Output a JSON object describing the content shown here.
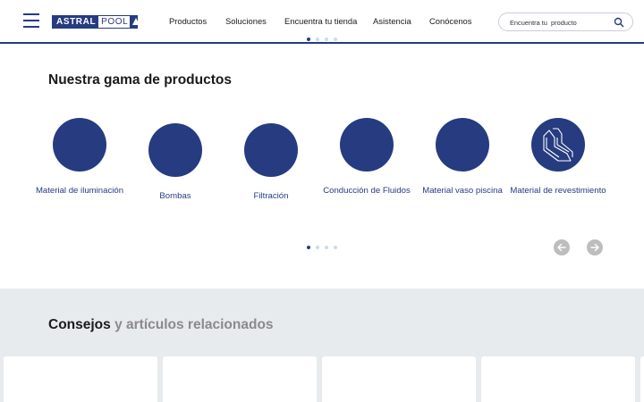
{
  "header": {
    "logo": {
      "part1": "ASTRAL",
      "part2": "POOL"
    },
    "nav": [
      "Productos",
      "Soluciones",
      "Encuentra tu tienda",
      "Asistencia",
      "Conócenos"
    ],
    "search": {
      "placeholder": "Encuentra tu  producto",
      "icon": "search-icon"
    }
  },
  "products": {
    "title": "Nuestra gama de productos",
    "items": [
      {
        "label": "Material de iluminación",
        "icon": "lighting-icon"
      },
      {
        "label": "Bombas",
        "icon": "pump-icon"
      },
      {
        "label": "Filtración",
        "icon": "filter-icon"
      },
      {
        "label": "Conducción de Fluidos",
        "icon": "pipe-icon"
      },
      {
        "label": "Material vaso piscina",
        "icon": "pool-icon"
      },
      {
        "label": "Material de revestimiento",
        "icon": "tiles-icon"
      }
    ],
    "pager": {
      "count": 4,
      "active": 1
    }
  },
  "articles": {
    "title_strong": "Consejos",
    "title_light": "y artículos relacionados",
    "card_count": 4
  },
  "colors": {
    "brand": "#263b80",
    "dot_inactive": "#c7ddf0",
    "arrow": "#bdbdbd",
    "articles_bg": "#e8ebee"
  }
}
